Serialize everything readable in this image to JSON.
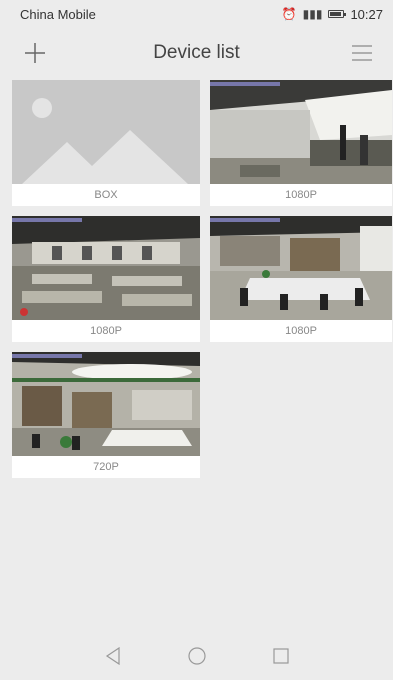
{
  "status_bar": {
    "carrier": "China Mobile",
    "time": "10:27"
  },
  "header": {
    "title": "Device list"
  },
  "devices": [
    {
      "label": "BOX",
      "thumbnail": "placeholder-image-icon"
    },
    {
      "label": "1080P",
      "thumbnail": "camera-feed"
    },
    {
      "label": "1080P",
      "thumbnail": "camera-feed"
    },
    {
      "label": "1080P",
      "thumbnail": "camera-feed"
    },
    {
      "label": "720P",
      "thumbnail": "camera-feed"
    }
  ],
  "nav": {
    "back": "back-icon",
    "home": "home-icon",
    "recents": "recents-icon"
  },
  "colors": {
    "background": "#ececec",
    "placeholder_bg": "#c8c8c8",
    "placeholder_shape": "#e4e4e4"
  }
}
